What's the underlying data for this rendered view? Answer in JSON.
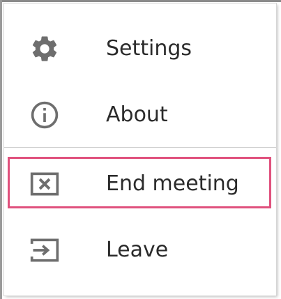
{
  "menu": {
    "items": [
      {
        "id": "settings",
        "label": "Settings",
        "icon": "gear-icon"
      },
      {
        "id": "about",
        "label": "About",
        "icon": "info-icon"
      },
      {
        "id": "end_meeting",
        "label": "End meeting",
        "icon": "close-box-icon"
      },
      {
        "id": "leave",
        "label": "Leave",
        "icon": "exit-icon"
      }
    ],
    "highlighted_item": "end_meeting"
  },
  "colors": {
    "icon": "#6e6e6e",
    "text": "#2b2b2b",
    "highlight_border": "#e0517d",
    "divider": "#cfcfcf"
  }
}
